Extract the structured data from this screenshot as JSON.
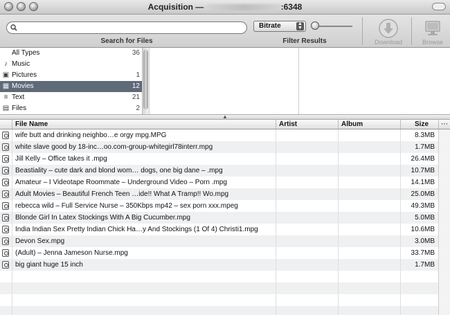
{
  "window": {
    "title_prefix": "Acquisition — ",
    "title_suffix": ":6348"
  },
  "toolbar": {
    "search_placeholder": "",
    "search_label": "Search for Files",
    "filter_selected": "Bitrate",
    "filter_label": "Filter Results",
    "download_label": "Download",
    "browse_label": "Browse"
  },
  "categories": [
    {
      "name": "All Types",
      "count": "36",
      "icon": "all-types-icon",
      "selected": false
    },
    {
      "name": "Music",
      "count": "",
      "icon": "music-icon",
      "selected": false
    },
    {
      "name": "Pictures",
      "count": "1",
      "icon": "pictures-icon",
      "selected": false
    },
    {
      "name": "Movies",
      "count": "12",
      "icon": "movies-icon",
      "selected": true
    },
    {
      "name": "Text",
      "count": "21",
      "icon": "text-icon",
      "selected": false
    },
    {
      "name": "Files",
      "count": "2",
      "icon": "files-icon",
      "selected": false
    }
  ],
  "table": {
    "columns": [
      "File Name",
      "Artist",
      "Album",
      "Size"
    ],
    "rows": [
      {
        "name": "wife butt            and drinking neighbo…e orgy                              mpg.MPG",
        "artist": "",
        "album": "",
        "size": "8.3MB"
      },
      {
        "name": "white        slave             good by 18-inc…oo.com-group-whitegirl78interr.mpg",
        "artist": "",
        "album": "",
        "size": "1.7MB"
      },
      {
        "name": "Jill Kelly – Office              takes it          .mpg",
        "artist": "",
        "album": "",
        "size": "26.4MB"
      },
      {
        "name": "Beastiality – cute dark and blond wom… dogs, one big dane –                .mpg",
        "artist": "",
        "album": "",
        "size": "10.7MB"
      },
      {
        "name": "Amateur – I Videotape Roommate               – Underground Video – Porn .mpg",
        "artist": "",
        "album": "",
        "size": "14.1MB"
      },
      {
        "name": "Adult Movies – Beautiful French Teen …ide!!  What A             Tramp!!  Wo.mpg",
        "artist": "",
        "album": "",
        "size": "25.0MB"
      },
      {
        "name": "rebecca wild – Full Service Nurse – 350Kbps mp42 – sex porn xxx.mpeg",
        "artist": "",
        "album": "",
        "size": "49.3MB"
      },
      {
        "name": "Blonde Girl In Latex Stockings                     With A Big Cucumber.mpg",
        "artist": "",
        "album": "",
        "size": "5.0MB"
      },
      {
        "name": "India Indian Sex Pretty Indian Chick Ha…y And Stockings (1 Of 4) Christi1.mpg",
        "artist": "",
        "album": "",
        "size": "10.6MB"
      },
      {
        "name": "Devon            Sex.mpg",
        "artist": "",
        "album": "",
        "size": "3.0MB"
      },
      {
        "name": "(Adult) – Jenna Jameson Nurse.mpg",
        "artist": "",
        "album": "",
        "size": "33.7MB"
      },
      {
        "name": "big giant huge 15 inch",
        "artist": "",
        "album": "",
        "size": "1.7MB"
      }
    ]
  }
}
